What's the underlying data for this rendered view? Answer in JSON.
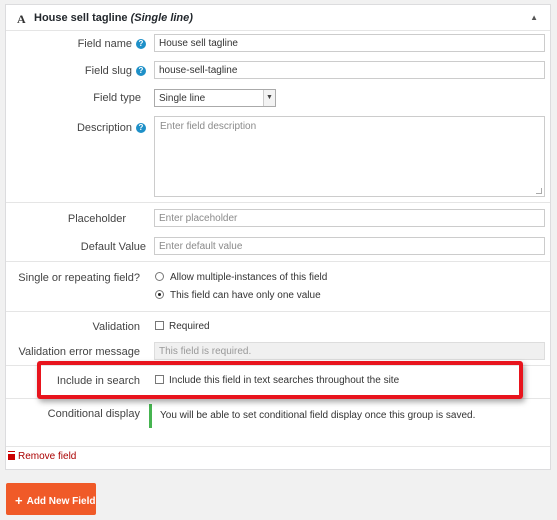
{
  "header": {
    "type_icon": "A",
    "title": "House sell tagline",
    "subtitle": "(Single line)",
    "collapse_icon": "triangle-up-icon"
  },
  "fields": {
    "field_name": {
      "label": "Field name",
      "help": "?",
      "value": "House sell tagline"
    },
    "field_slug": {
      "label": "Field slug",
      "help": "?",
      "value": "house-sell-tagline"
    },
    "field_type": {
      "label": "Field type",
      "value": "Single line"
    },
    "description": {
      "label": "Description",
      "help": "?",
      "placeholder": "Enter field description"
    },
    "placeholder": {
      "label": "Placeholder",
      "placeholder": "Enter placeholder"
    },
    "default_value": {
      "label": "Default Value",
      "help": "?",
      "placeholder": "Enter default value"
    }
  },
  "repeating": {
    "label": "Single or repeating field?",
    "options": [
      {
        "label": "Allow multiple-instances of this field",
        "checked": false
      },
      {
        "label": "This field can have only one value",
        "checked": true
      }
    ]
  },
  "validation": {
    "label": "Validation",
    "required_label": "Required",
    "error_label": "Validation error message",
    "error_placeholder": "This field is required."
  },
  "search": {
    "label": "Include in search",
    "option_label": "Include this field in text searches throughout the site"
  },
  "conditional": {
    "label": "Conditional display",
    "notice": "You will be able to set conditional field display once this group is saved."
  },
  "remove_label": "Remove field",
  "add_button_label": "Add New Field",
  "colors": {
    "accent_orange": "#f05a28",
    "highlight_red": "#e8141d",
    "notice_green": "#46b450",
    "help_blue": "#1e90c8",
    "remove_red": "#a00"
  }
}
